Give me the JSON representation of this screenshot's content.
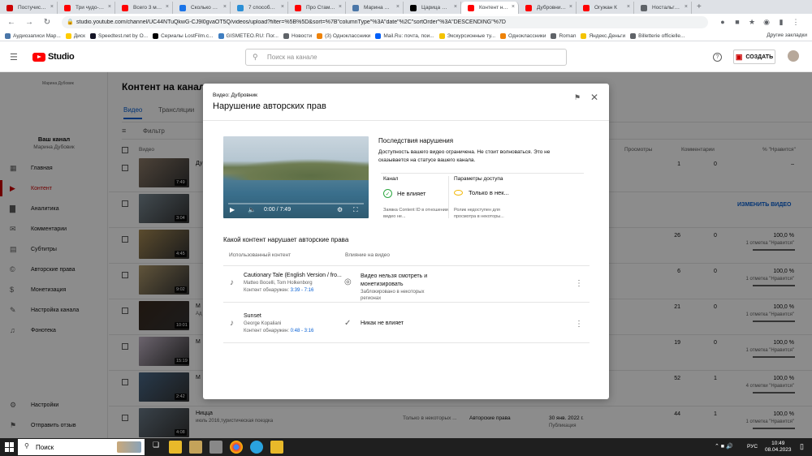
{
  "browser": {
    "tabs": [
      {
        "label": "Постучись в",
        "color": "#cc0000",
        "active": false
      },
      {
        "label": "Три чудо-упр",
        "color": "#ff0000",
        "active": false
      },
      {
        "label": "Всего 3 мину",
        "color": "#ff0000",
        "active": false
      },
      {
        "label": "Сколько стоя",
        "color": "#1a73e8",
        "active": false
      },
      {
        "label": "7 способов с",
        "color": "#2b8fd6",
        "active": false
      },
      {
        "label": "Про Стамбул",
        "color": "#ff0000",
        "active": false
      },
      {
        "label": "Марина Дубо",
        "color": "#4a76a8",
        "active": false
      },
      {
        "label": "Царица Сава",
        "color": "#000000",
        "active": false
      },
      {
        "label": "Контент на к",
        "color": "#ff0000",
        "active": true
      },
      {
        "label": "Дубровник -",
        "color": "#ff0000",
        "active": false
      },
      {
        "label": "Огужан К",
        "color": "#ff0000",
        "active": false
      },
      {
        "label": "Ностальгия.",
        "color": "#5f6368",
        "active": false
      }
    ],
    "url": "studio.youtube.com/channel/UC44NTuQkwG-CJ9l0gvaOT5Q/videos/upload?filter=%5B%5D&sort=%7B\"columnType\"%3A\"date\"%2C\"sortOrder\"%3A\"DESCENDING\"%7D",
    "bookmarks": [
      {
        "label": "Аудиозаписи Мар...",
        "color": "#4a76a8"
      },
      {
        "label": "Диск",
        "color": "#ffcc00"
      },
      {
        "label": "Speedtest.net by O...",
        "color": "#141526"
      },
      {
        "label": "Сериалы LostFilm.c...",
        "color": "#000000"
      },
      {
        "label": "GISMETEO.RU: Пог...",
        "color": "#3f7ec1"
      },
      {
        "label": "Новости",
        "color": "#5f6368"
      },
      {
        "label": "(3) Одноклассники",
        "color": "#ee8208"
      },
      {
        "label": "Mail.Ru: почта, пои...",
        "color": "#005ff9"
      },
      {
        "label": "Экскурсионные ту...",
        "color": "#f4c300"
      },
      {
        "label": "Одноклассники",
        "color": "#ee8208"
      },
      {
        "label": "Roman",
        "color": "#5f6368"
      },
      {
        "label": "Яндекс.Деньги",
        "color": "#f4c300"
      },
      {
        "label": "Billetterie officielle...",
        "color": "#5f6368"
      }
    ],
    "other_bookmarks": "Другие закладки"
  },
  "studio": {
    "logo": "Studio",
    "search_placeholder": "Поиск на канале",
    "create_label": "СОЗДАТЬ",
    "channel_label": "Ваш канал",
    "channel_name": "Марина Дубовик",
    "avatar_caption": "Марина Дубовик",
    "sidebar": [
      {
        "label": "Главная",
        "icon": "dashboard-icon",
        "active": false
      },
      {
        "label": "Контент",
        "icon": "content-icon",
        "active": true
      },
      {
        "label": "Аналитика",
        "icon": "analytics-icon",
        "active": false
      },
      {
        "label": "Комментарии",
        "icon": "comments-icon",
        "active": false
      },
      {
        "label": "Субтитры",
        "icon": "subtitles-icon",
        "active": false
      },
      {
        "label": "Авторские права",
        "icon": "copyright-icon",
        "active": false
      },
      {
        "label": "Монетизация",
        "icon": "monetization-icon",
        "active": false
      },
      {
        "label": "Настройка канала",
        "icon": "customization-icon",
        "active": false
      },
      {
        "label": "Фонотека",
        "icon": "audio-library-icon",
        "active": false
      }
    ],
    "sidebar_bottom": [
      {
        "label": "Настройки",
        "icon": "settings-icon"
      },
      {
        "label": "Отправить отзыв",
        "icon": "feedback-icon"
      }
    ],
    "page_title": "Контент на канале",
    "tabs": [
      {
        "label": "Видео",
        "active": true
      },
      {
        "label": "Трансляции",
        "active": false
      }
    ],
    "filter_label": "Фильтр",
    "columns": {
      "video": "Видео",
      "views": "Просмотры",
      "comments": "Комментарии",
      "likes": "% \"Нравится\""
    },
    "change_video_label": "ИЗМЕНИТЬ ВИДЕО",
    "rows": [
      {
        "title": "Ду",
        "desc": "",
        "duration": "7:49",
        "views": "1",
        "comments": "0",
        "likes": "–",
        "likes_sub": "",
        "thumb": "#8c7a68"
      },
      {
        "title": "",
        "desc": "",
        "duration": "3:04",
        "views": "",
        "comments": "",
        "likes": "",
        "likes_sub": "",
        "thumb": "#7a8a94"
      },
      {
        "title": "",
        "desc": "",
        "duration": "4:45",
        "views": "26",
        "comments": "0",
        "likes": "100,0 %",
        "likes_sub": "1 отметка \"Нравится\"",
        "thumb": "#a68a54"
      },
      {
        "title": "",
        "desc": "",
        "duration": "9:02",
        "views": "6",
        "comments": "0",
        "likes": "100,0 %",
        "likes_sub": "1 отметка \"Нравится\"",
        "thumb": "#b09a6c"
      },
      {
        "title": "М",
        "desc": "Ад",
        "duration": "10:01",
        "views": "21",
        "comments": "0",
        "likes": "100,0 %",
        "likes_sub": "1 отметка \"Нравится\"",
        "thumb": "#3a2a1e"
      },
      {
        "title": "М",
        "desc": "",
        "duration": "15:19",
        "views": "19",
        "comments": "0",
        "likes": "100,0 %",
        "likes_sub": "1 отметка \"Нравится\"",
        "thumb": "#c4b6c8"
      },
      {
        "title": "М",
        "desc": "",
        "duration": "2:42",
        "views": "52",
        "comments": "1",
        "likes": "100,0 %",
        "likes_sub": "4 отметки \"Нравится\"",
        "thumb": "#4a6a8a"
      },
      {
        "title": "Ницца",
        "desc": "июль 2016,туристическая поездка",
        "duration": "4:08",
        "views": "44",
        "comments": "1",
        "likes": "100,0 %",
        "likes_sub": "1 отметка \"Нравится\"",
        "thumb": "#6a7a88"
      }
    ],
    "last_row_extra": {
      "access": "Только в некоторых ...",
      "restriction": "Авторские права",
      "date": "30 янв. 2022 г.",
      "date_sub": "Публикация"
    }
  },
  "modal": {
    "subtitle": "Видео: Дубровник",
    "title": "Нарушение авторских прав",
    "player_time": "0:00 / 7:49",
    "consequences_title": "Последствия нарушения",
    "consequences_text": "Доступность вашего видео ограничена. Не стоит волноваться. Это не сказывается на статусе вашего канала.",
    "channel_col": {
      "label": "Канал",
      "status": "Не влияет",
      "note": "Заявка Content ID в отношении видео не..."
    },
    "access_col": {
      "label": "Параметры доступа",
      "status": "Только в нек...",
      "note": "Ролик недоступен для просмотра в некоторы..."
    },
    "section_title": "Какой контент нарушает авторские права",
    "table_headers": {
      "content": "Использованный контент",
      "impact": "Влияние на видео"
    },
    "claims": [
      {
        "song": "Cautionary Tale (English Version / fro...",
        "artist": "Matteo Bocelli, Tom Holkenborg",
        "found_label": "Контент обнаружен:",
        "found_range": "3:39 - 7:16",
        "impact": "Видео нельзя смотреть и монетизировать",
        "impact_note": "Заблокировано в некоторых регионах",
        "impact_icon": "visibility-off-icon"
      },
      {
        "song": "Sunset",
        "artist": "George Kopaliani",
        "found_label": "Контент обнаружен:",
        "found_range": "0:48 - 3:16",
        "impact": "Никак не влияет",
        "impact_note": "",
        "impact_icon": "checkmark-icon"
      }
    ]
  },
  "taskbar": {
    "search_label": "Поиск",
    "lang": "РУС",
    "time": "10:49",
    "date": "08.04.2023"
  }
}
